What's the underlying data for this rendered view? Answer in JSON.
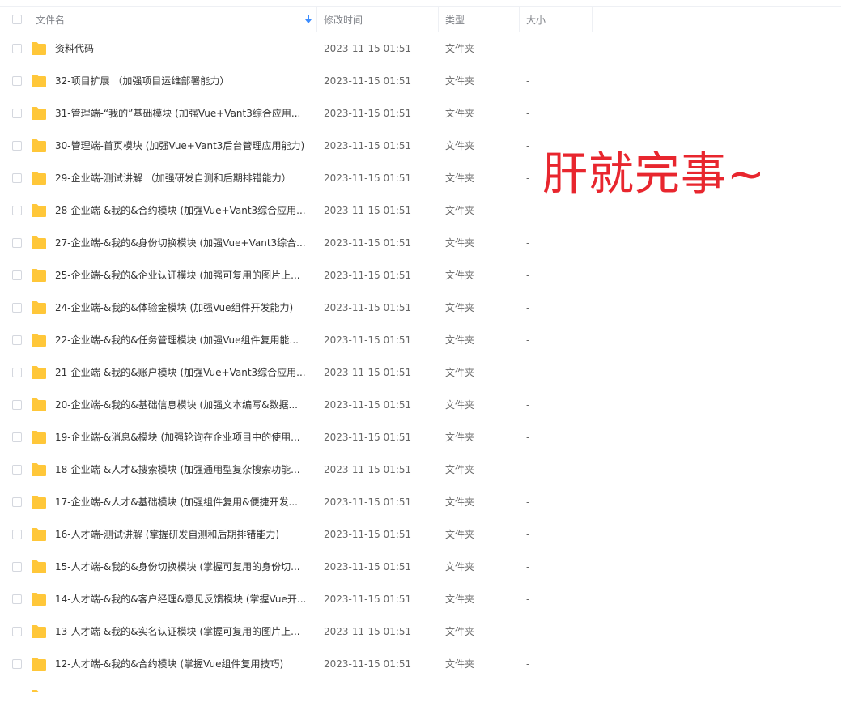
{
  "header": {
    "name_label": "文件名",
    "mtime_label": "修改时间",
    "type_label": "类型",
    "size_label": "大小"
  },
  "overlay_text": "肝就完事~",
  "colors": {
    "folder": "#ffc73a",
    "overlay": "#e8262e"
  },
  "files": [
    {
      "name": "资料代码",
      "mtime": "2023-11-15 01:51",
      "type": "文件夹",
      "size": "-"
    },
    {
      "name": "32-项目扩展 （加强项目运维部署能力）",
      "mtime": "2023-11-15 01:51",
      "type": "文件夹",
      "size": "-"
    },
    {
      "name": "31-管理端-“我的”基础模块 (加强Vue+Vant3综合应用...",
      "mtime": "2023-11-15 01:51",
      "type": "文件夹",
      "size": "-"
    },
    {
      "name": "30-管理端-首页模块 (加强Vue+Vant3后台管理应用能力)",
      "mtime": "2023-11-15 01:51",
      "type": "文件夹",
      "size": "-"
    },
    {
      "name": "29-企业端-测试讲解 （加强研发自测和后期排错能力）",
      "mtime": "2023-11-15 01:51",
      "type": "文件夹",
      "size": "-"
    },
    {
      "name": "28-企业端-&我的&合约模块 (加强Vue+Vant3综合应用...",
      "mtime": "2023-11-15 01:51",
      "type": "文件夹",
      "size": "-"
    },
    {
      "name": "27-企业端-&我的&身份切换模块 (加强Vue+Vant3综合...",
      "mtime": "2023-11-15 01:51",
      "type": "文件夹",
      "size": "-"
    },
    {
      "name": "25-企业端-&我的&企业认证模块 (加强可复用的图片上...",
      "mtime": "2023-11-15 01:51",
      "type": "文件夹",
      "size": "-"
    },
    {
      "name": "24-企业端-&我的&体验金模块 (加强Vue组件开发能力)",
      "mtime": "2023-11-15 01:51",
      "type": "文件夹",
      "size": "-"
    },
    {
      "name": "22-企业端-&我的&任务管理模块 (加强Vue组件复用能...",
      "mtime": "2023-11-15 01:51",
      "type": "文件夹",
      "size": "-"
    },
    {
      "name": "21-企业端-&我的&账户模块 (加强Vue+Vant3综合应用...",
      "mtime": "2023-11-15 01:51",
      "type": "文件夹",
      "size": "-"
    },
    {
      "name": "20-企业端-&我的&基础信息模块 (加强文本编写&数据...",
      "mtime": "2023-11-15 01:51",
      "type": "文件夹",
      "size": "-"
    },
    {
      "name": "19-企业端-&消息&模块 (加强轮询在企业项目中的使用...",
      "mtime": "2023-11-15 01:51",
      "type": "文件夹",
      "size": "-"
    },
    {
      "name": "18-企业端-&人才&搜索模块 (加强通用型复杂搜索功能...",
      "mtime": "2023-11-15 01:51",
      "type": "文件夹",
      "size": "-"
    },
    {
      "name": "17-企业端-&人才&基础模块 (加强组件复用&便捷开发...",
      "mtime": "2023-11-15 01:51",
      "type": "文件夹",
      "size": "-"
    },
    {
      "name": "16-人才端-测试讲解 (掌握研发自测和后期排错能力)",
      "mtime": "2023-11-15 01:51",
      "type": "文件夹",
      "size": "-"
    },
    {
      "name": "15-人才端-&我的&身份切换模块 (掌握可复用的身份切...",
      "mtime": "2023-11-15 01:51",
      "type": "文件夹",
      "size": "-"
    },
    {
      "name": "14-人才端-&我的&客户经理&意见反馈模块 (掌握Vue开...",
      "mtime": "2023-11-15 01:51",
      "type": "文件夹",
      "size": "-"
    },
    {
      "name": "13-人才端-&我的&实名认证模块 (掌握可复用的图片上...",
      "mtime": "2023-11-15 01:51",
      "type": "文件夹",
      "size": "-"
    },
    {
      "name": "12-人才端-&我的&合约模块 (掌握Vue组件复用技巧)",
      "mtime": "2023-11-15 01:51",
      "type": "文件夹",
      "size": "-"
    }
  ]
}
